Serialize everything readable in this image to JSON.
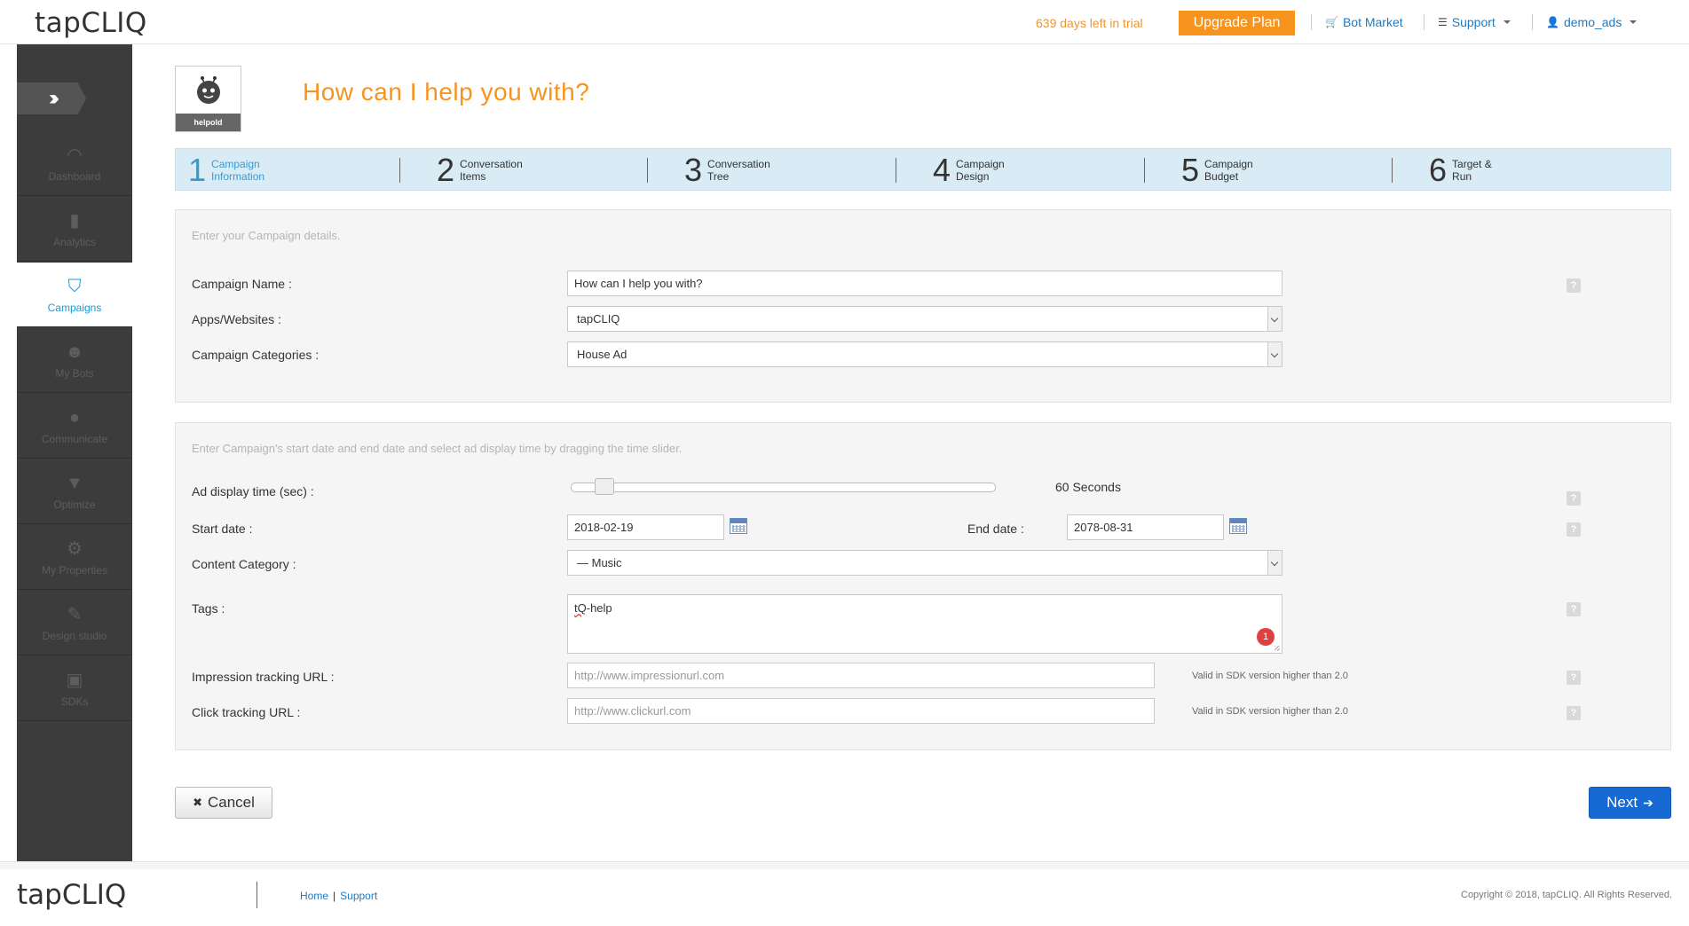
{
  "header": {
    "brand": "tapCLIQ",
    "trial_text": "639 days left in trial",
    "upgrade_label": "Upgrade Plan",
    "bot_market": "Bot Market",
    "support": "Support",
    "user": "demo_ads"
  },
  "sidebar": {
    "items": [
      {
        "label": "Dashboard",
        "icon": "dashboard-icon"
      },
      {
        "label": "Analytics",
        "icon": "analytics-icon"
      },
      {
        "label": "Campaigns",
        "icon": "campaigns-icon"
      },
      {
        "label": "My Bots",
        "icon": "bot-icon"
      },
      {
        "label": "Communicate",
        "icon": "chat-icon"
      },
      {
        "label": "Optimize",
        "icon": "filter-icon"
      },
      {
        "label": "My Properties",
        "icon": "gear-icon"
      },
      {
        "label": "Design studio",
        "icon": "design-icon"
      },
      {
        "label": "SDKs",
        "icon": "sdk-icon"
      }
    ],
    "active": "Campaigns"
  },
  "avatar": {
    "caption": "helpold"
  },
  "page_title": "How can I help you with?",
  "steps": [
    {
      "num": "1",
      "line1": "Campaign",
      "line2": "Information"
    },
    {
      "num": "2",
      "line1": "Conversation",
      "line2": "Items"
    },
    {
      "num": "3",
      "line1": "Conversation",
      "line2": "Tree"
    },
    {
      "num": "4",
      "line1": "Campaign",
      "line2": "Design"
    },
    {
      "num": "5",
      "line1": "Campaign",
      "line2": "Budget"
    },
    {
      "num": "6",
      "line1": "Target &",
      "line2": "Run"
    }
  ],
  "panel1": {
    "hint": "Enter your Campaign details.",
    "campaign_name_label": "Campaign Name :",
    "campaign_name_value": "How can I help you with?",
    "apps_label": "Apps/Websites :",
    "apps_value": "tapCLIQ",
    "categories_label": "Campaign Categories :",
    "categories_value": "House Ad"
  },
  "panel2": {
    "hint": "Enter Campaign's start date and end date and select ad display time by dragging the time slider.",
    "display_time_label": "Ad display time (sec) :",
    "display_time_value": "60 Seconds",
    "slider_fraction": 0.06,
    "start_label": "Start date :",
    "start_value": "2018-02-19",
    "end_label": "End date :",
    "end_value": "2078-08-31",
    "content_category_label": "Content Category :",
    "content_category_value": "— Music",
    "tags_label": "Tags :",
    "tags_value_underlined": "tQ",
    "tags_value_rest": "-help",
    "tags_badge": "1",
    "impression_label": "Impression tracking URL :",
    "impression_placeholder": "http://www.impressionurl.com",
    "click_label": "Click tracking URL :",
    "click_placeholder": "http://www.clickurl.com",
    "sdk_note": "Valid in SDK version higher than 2.0"
  },
  "help_glyph": "?",
  "actions": {
    "cancel": "Cancel",
    "next": "Next"
  },
  "footer": {
    "brand": "tapCLIQ",
    "home": "Home",
    "separator": "|",
    "support": "Support",
    "copyright": "Copyright © 2018, tapCLIQ. All Rights Reserved."
  }
}
